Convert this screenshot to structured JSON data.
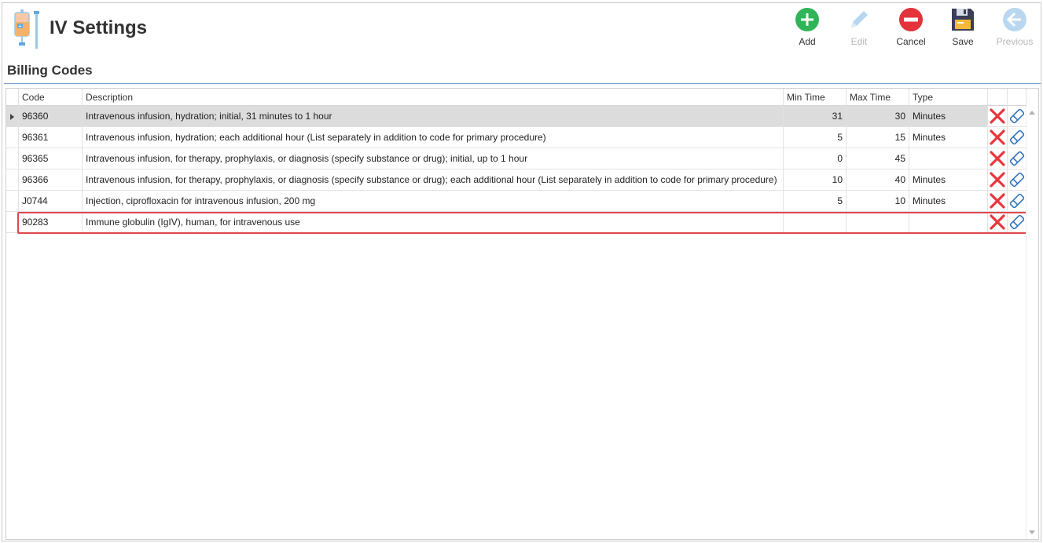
{
  "header": {
    "title": "IV Settings"
  },
  "toolbar": {
    "add": {
      "label": "Add",
      "color": "#2fb457"
    },
    "edit": {
      "label": "Edit",
      "color": "#9fc6e8"
    },
    "cancel": {
      "label": "Cancel",
      "color": "#e3343c"
    },
    "save": {
      "label": "Save",
      "color": "#3a3f55"
    },
    "previous": {
      "label": "Previous",
      "color": "#b9d8ef"
    }
  },
  "section": {
    "title": "Billing Codes"
  },
  "grid": {
    "columns": {
      "code": "Code",
      "description": "Description",
      "min_time": "Min Time",
      "max_time": "Max Time",
      "type": "Type"
    },
    "rows": [
      {
        "code": "96360",
        "description": "Intravenous infusion, hydration; initial, 31 minutes to 1 hour",
        "min_time": "31",
        "max_time": "30",
        "type": "Minutes",
        "selected": true
      },
      {
        "code": "96361",
        "description": "Intravenous infusion, hydration; each additional hour (List separately in addition to code for primary procedure)",
        "min_time": "5",
        "max_time": "15",
        "type": "Minutes"
      },
      {
        "code": "96365",
        "description": "Intravenous infusion, for therapy, prophylaxis, or diagnosis (specify substance or drug); initial, up to 1 hour",
        "min_time": "0",
        "max_time": "45",
        "type": ""
      },
      {
        "code": "96366",
        "description": "Intravenous infusion, for therapy, prophylaxis, or diagnosis (specify substance or drug); each additional hour (List separately in addition to code for primary procedure)",
        "min_time": "10",
        "max_time": "40",
        "type": "Minutes"
      },
      {
        "code": "J0744",
        "description": "Injection, ciprofloxacin for intravenous infusion, 200 mg",
        "min_time": "5",
        "max_time": "10",
        "type": "Minutes"
      },
      {
        "code": "90283",
        "description": "Immune globulin (IgIV), human, for intravenous use",
        "min_time": "",
        "max_time": "",
        "type": "",
        "highlighted": true
      }
    ],
    "delete_icon_color": "#e8363c",
    "edit_icon_color": "#2f74c0"
  }
}
